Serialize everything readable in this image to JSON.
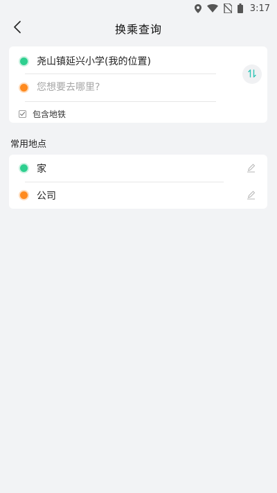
{
  "status_bar": {
    "time": "3:17",
    "icons": [
      "location-icon",
      "wifi-icon",
      "no-sim-icon",
      "battery-icon"
    ]
  },
  "header": {
    "title": "换乘查询",
    "back_icon": "chevron-left-icon"
  },
  "route": {
    "start": "尧山镇延兴小学(我的位置)",
    "destination_value": "",
    "destination_placeholder": "您想要去哪里?",
    "swap_icon": "swap-vertical-icon",
    "include_subway_label": "包含地铁",
    "include_subway_checked": true
  },
  "favorites": {
    "section_title": "常用地点",
    "items": [
      {
        "label": "家",
        "dot": "start",
        "edit_icon": "pencil-icon"
      },
      {
        "label": "公司",
        "dot": "end",
        "edit_icon": "pencil-icon"
      }
    ]
  },
  "colors": {
    "background": "#f2f3f5",
    "start_dot": "#2ecf8f",
    "end_dot": "#ff8a1e",
    "accent": "#2ec4b6"
  }
}
